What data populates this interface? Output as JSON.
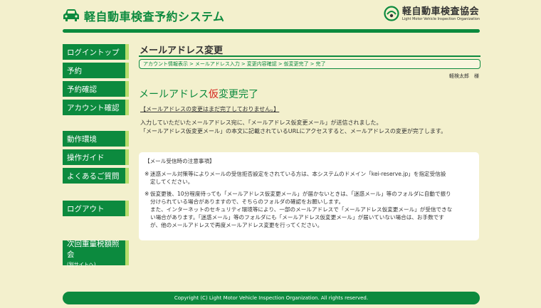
{
  "header": {
    "site_title": "軽自動車検査予約システム",
    "org_name_jp": "軽自動車検査協会",
    "org_name_en": "Light Motor Vehicle Inspection Organization"
  },
  "sidebar": {
    "items": [
      {
        "label": "ログイントップ"
      },
      {
        "label": "予約"
      },
      {
        "label": "予約確認"
      },
      {
        "label": "アカウント確認"
      },
      {
        "label": "動作環境"
      },
      {
        "label": "操作ガイド"
      },
      {
        "label": "よくあるご質問"
      },
      {
        "label": "ログアウト"
      },
      {
        "label": "次回重量税額照会",
        "sub": "(別サイトへ)"
      }
    ]
  },
  "main": {
    "heading": "メールアドレス変更",
    "breadcrumb": [
      "アカウント情報表示",
      "メールアドレス入力",
      "変更内容確認",
      "仮変更完了",
      "完了"
    ],
    "breadcrumb_sep": ">",
    "username": "軽検太郎　様",
    "done_title_pre": "メールアドレス",
    "done_title_red": "仮",
    "done_title_post": "変更完了",
    "notice": "【メールアドレスの変更はまだ完了しておりません。】",
    "desc_line1": "入力していただいたメールアドレス宛に、「メールアドレス仮変更メール」が送信されました。",
    "desc_line2": "「メールアドレス仮変更メール」の本文に記載されているURLにアクセスすると、メールアドレスの変更が完了します。"
  },
  "info": {
    "title": "【メール受信時の注意事項】",
    "mark": "※",
    "item1_line1": "迷惑メール対策等によりメールの受信拒否設定をされている方は、本システムのドメイン「kei-reserve.jp」を指定受信設",
    "item1_line2": "定してください。",
    "item2_line1": "仮変更後、10分程度待っても「メールアドレス仮変更メール」が届かないときは、「迷惑メール」等のフォルダに自動で振り",
    "item2_line2": "分けられている場合がありますので、そちらのフォルダの確認をお願いします。",
    "item2_line3": "また、インターネットのセキュリティ環境等により、一部のメールアドレスで「メールアドレス仮変更メール」が受信できな",
    "item2_line4": "い場合があります。「迷惑メール」等のフォルダにも「メールアドレス仮変更メール」が届いていない場合は、お手数です",
    "item2_line5": "が、他のメールアドレスで再度メールアドレス変更を行ってください。"
  },
  "footer": {
    "copyright": "Copyright (C) Light Motor Vehicle Inspection Organization. All rights reserved."
  },
  "colors": {
    "brand_green": "#0c8a3e",
    "accent_lime": "#b6dd6b",
    "background": "#f3f0cd",
    "highlight_red": "#d3241c"
  }
}
